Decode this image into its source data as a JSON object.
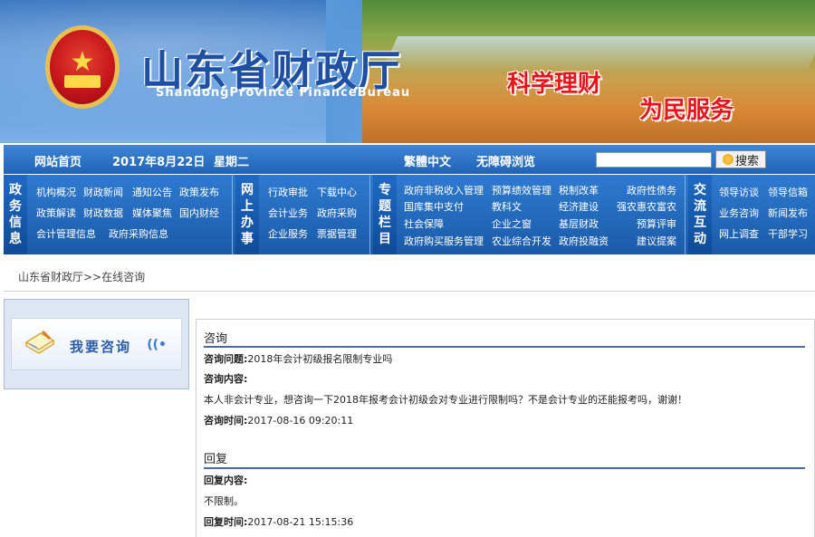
{
  "banner": {
    "title_cn": "山东省财政厅",
    "title_en": "ShandongProvince FinanceBureau",
    "slogan1": "科学理财",
    "slogan2": "为民服务"
  },
  "topnav": {
    "home": "网站首页",
    "date": "2017年8月22日",
    "weekday": "星期二",
    "traditional": "繁體中文",
    "accessible": "无障碍浏览",
    "search_value": "",
    "search_button": "搜索"
  },
  "catnav": {
    "gov_info": {
      "label": [
        "政",
        "务",
        "信",
        "息"
      ],
      "items": [
        "机构概况",
        "财政新闻",
        "通知公告",
        "政策发布",
        "政策解读",
        "财政数据",
        "媒体聚焦",
        "国内财经",
        "会计管理信息",
        "政府采购信息"
      ]
    },
    "online": {
      "label": [
        "网",
        "上",
        "办",
        "事"
      ],
      "items": [
        "行政审批",
        "下载中心",
        "会计业务",
        "政府采购",
        "企业服务",
        "票据管理"
      ]
    },
    "special": {
      "label": [
        "专",
        "题",
        "栏",
        "目"
      ],
      "items": [
        "政府非税收入管理",
        "预算绩效管理",
        "税制改革",
        "政府性债务",
        "国库集中支付",
        "教科文",
        "经济建设",
        "强农惠农富农",
        "社会保障",
        "企业之窗",
        "基层财政",
        "预算评审",
        "政府购买服务管理",
        "农业综合开发",
        "政府投融资",
        "建议提案"
      ]
    },
    "exchange": {
      "label": [
        "交",
        "流",
        "互",
        "动"
      ],
      "items": [
        "领导访谈",
        "领导信箱",
        "业务咨询",
        "新闻发布",
        "网上调查",
        "干部学习"
      ]
    }
  },
  "breadcrumb": "山东省财政厅>>在线咨询",
  "leftbox": {
    "button_label": "我要咨询"
  },
  "consult": {
    "heading": "咨询",
    "question_label": "咨询问题:",
    "question": "2018年会计初级报名限制专业吗",
    "content_label": "咨询内容:",
    "content": "本人非会计专业，想咨询一下2018年报考会计初级会对专业进行限制吗？不是会计专业的还能报考吗，谢谢！",
    "time_label": "咨询时间:",
    "time": "2017-08-16 09:20:11"
  },
  "reply": {
    "heading": "回复",
    "content_label": "回复内容:",
    "content": "不限制。",
    "time_label": "回复时间:",
    "time": "2017-08-21 15:15:36"
  }
}
